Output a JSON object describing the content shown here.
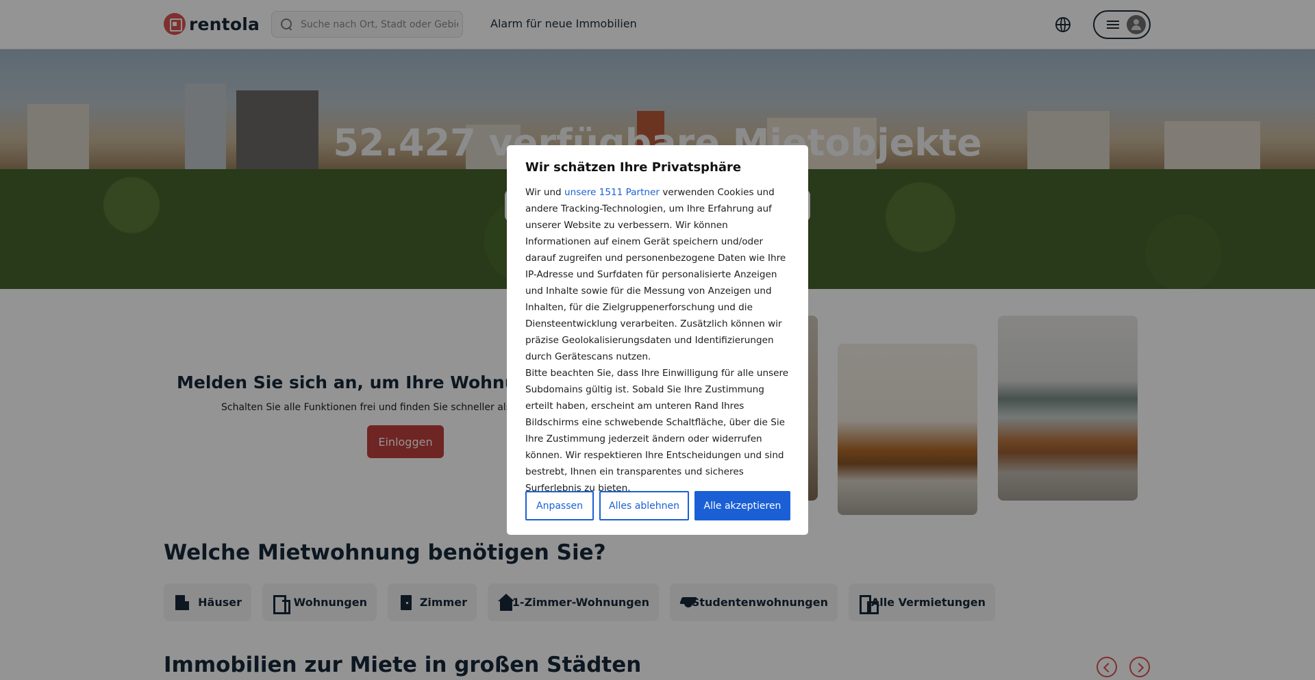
{
  "header": {
    "logo_text": "rentola",
    "search_placeholder": "Suche nach Ort, Stadt oder Gebiet",
    "alarm_link": "Alarm für neue Immobilien"
  },
  "hero": {
    "title": "52.427 verfügbare Mietobjekte"
  },
  "login": {
    "title": "Melden Sie sich an, um Ihre Wohnungssuche",
    "subtitle": "Schalten Sie alle Funktionen frei und finden Sie schneller als je zu",
    "button": "Einloggen"
  },
  "categories": {
    "title": "Welche Mietwohnung benötigen Sie?",
    "items": [
      {
        "label": "Häuser",
        "icon": "house-icon"
      },
      {
        "label": "Wohnungen",
        "icon": "apartment-icon"
      },
      {
        "label": "Zimmer",
        "icon": "door-icon"
      },
      {
        "label": "1-Zimmer-Wohnungen",
        "icon": "home-icon"
      },
      {
        "label": "Studentenwohnungen",
        "icon": "graduation-cap-icon"
      },
      {
        "label": "Alle Vermietungen",
        "icon": "all-rentals-icon"
      }
    ]
  },
  "cities": {
    "title": "Immobilien zur Miete in großen Städten"
  },
  "consent": {
    "title": "Wir schätzen Ihre Privatsphäre",
    "text_before_link": "Wir und ",
    "partner_link": "unsere 1511 Partner",
    "text_after_link": " verwenden Cookies und andere Tracking-Technologien, um Ihre Erfahrung auf unserer Website zu verbessern. Wir können Informationen auf einem Gerät speichern und/oder darauf zugreifen und personenbezogene Daten wie Ihre IP-Adresse und Surfdaten für personalisierte Anzeigen und Inhalte sowie für die Messung von Anzeigen und Inhalten, für die Zielgruppenerforschung und die Diensteentwicklung verarbeiten. Zusätzlich können wir präzise Geolokalisierungsdaten und Identifizierungen durch Gerätescans nutzen.",
    "paragraph_2": "Bitte beachten Sie, dass Ihre Einwilligung für alle unsere Subdomains gültig ist. Sobald Sie Ihre Zustimmung erteilt haben, erscheint am unteren Rand Ihres Bildschirms eine schwebende Schaltfläche, über die Sie Ihre Zustimmung jederzeit ändern oder widerrufen können. Wir respektieren Ihre Entscheidungen und sind bestrebt, Ihnen ein transparentes und sicheres Surferlebnis zu bieten.",
    "btn_customize": "Anpassen",
    "btn_reject": "Alles ablehnen",
    "btn_accept": "Alle akzeptieren"
  },
  "colors": {
    "brand": "#d9534f",
    "accent_blue": "#1a5fd6",
    "text_dark": "#17293a"
  }
}
